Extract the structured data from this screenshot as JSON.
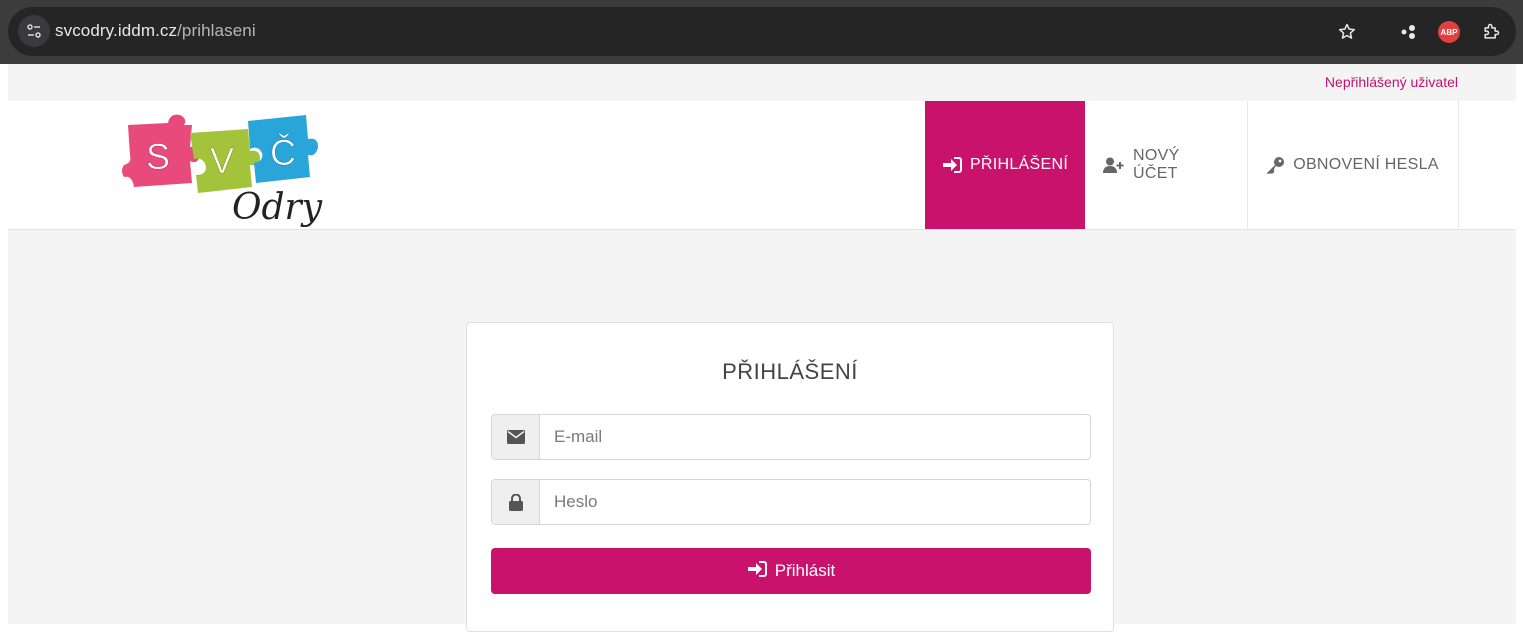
{
  "browser": {
    "url_host": "svcodry.iddm.cz",
    "url_path": "/prihlaseni",
    "abp_label": "ABP"
  },
  "top_strip": {
    "user_status": "Nepřihlášený uživatel"
  },
  "logo": {
    "letters": [
      "S",
      "V",
      "Č"
    ],
    "script": "Odry"
  },
  "nav": {
    "items": [
      {
        "label": "PŘIHLÁŠENÍ",
        "icon": "sign-in-icon",
        "active": true
      },
      {
        "label": "NOVÝ ÚČET",
        "icon": "user-plus-icon",
        "active": false
      },
      {
        "label": "OBNOVENÍ HESLA",
        "icon": "key-icon",
        "active": false
      }
    ]
  },
  "login": {
    "title": "PŘIHLÁŠENÍ",
    "email_placeholder": "E-mail",
    "password_placeholder": "Heslo",
    "submit_label": "Přihlásit"
  },
  "colors": {
    "accent": "#c8126c",
    "status_text": "#c3126b"
  }
}
